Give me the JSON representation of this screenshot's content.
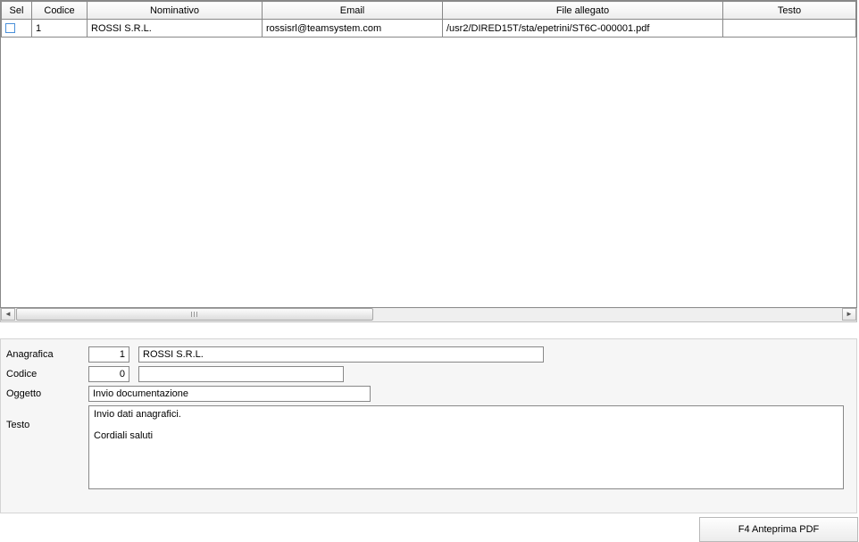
{
  "grid": {
    "headers": {
      "sel": "Sel",
      "codice": "Codice",
      "nominativo": "Nominativo",
      "email": "Email",
      "file_allegato": "File allegato",
      "testo": "Testo"
    },
    "rows": [
      {
        "sel": false,
        "codice": "1",
        "nominativo": "ROSSI S.R.L.",
        "email": "rossisrl@teamsystem.com",
        "file_allegato": "/usr2/DIRED15T/sta/epetrini/ST6C-000001.pdf",
        "testo": ""
      }
    ]
  },
  "form": {
    "labels": {
      "anagrafica": "Anagrafica",
      "codice": "Codice",
      "oggetto": "Oggetto",
      "testo": "Testo"
    },
    "anagrafica_id": "1",
    "anagrafica_nome": "ROSSI S.R.L.",
    "codice_id": "0",
    "codice_desc": "",
    "oggetto": "Invio documentazione",
    "testo": "Invio dati anagrafici.\n\nCordiali saluti"
  },
  "actions": {
    "anteprima_pdf": "F4 Anteprima PDF"
  }
}
